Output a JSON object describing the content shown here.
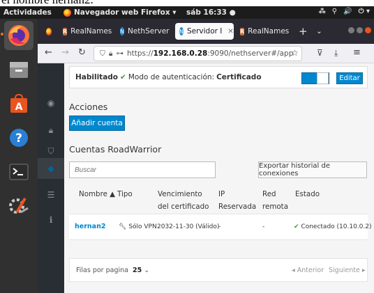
{
  "caption": "el nombre hernan2.",
  "topbar": {
    "activities": "Actividades",
    "app_menu": "Navegador web Firefox ▾",
    "clock": "sáb 16:33 ●",
    "tray": [
      "⁂",
      "⚲",
      "🔊",
      "⏻ ▾"
    ]
  },
  "browser": {
    "tabs": [
      {
        "label": "RealNames",
        "favicon": "R"
      },
      {
        "label": "NethServer",
        "favicon": "N"
      },
      {
        "label": "Servidor I",
        "favicon": "N",
        "active": true
      },
      {
        "label": "RealNames",
        "favicon": "R"
      }
    ],
    "url_prefix": "https://",
    "url_host": "192.168.0.28",
    "url_rest": ":9090/nethserver#/app"
  },
  "status": {
    "enabled_label": "Habilitado",
    "auth_label": "Modo de autenticación:",
    "auth_value": "Certificado",
    "edit_label": "Editar"
  },
  "actions": {
    "title": "Acciones",
    "add_account": "Añadir cuenta"
  },
  "accounts": {
    "title": "Cuentas RoadWarrior",
    "search_placeholder": "Buscar",
    "export_label": "Exportar historial de conexiones",
    "columns": {
      "name": "Nombre ▲",
      "type": "Tipo",
      "expiry_1": "Vencimiento",
      "expiry_2": "del certificado",
      "ip_1": "IP",
      "ip_2": "Reservada",
      "net_1": "Red",
      "net_2": "remota",
      "state": "Estado"
    },
    "rows": [
      {
        "name": "hernan2",
        "type": "Sólo VPN",
        "expiry": "2032-11-30 (Válido)",
        "ip": "-",
        "net": "-",
        "state": "Conectado (10.10.0.2)"
      }
    ]
  },
  "pagination": {
    "per_page_label": "Filas por pagina",
    "per_page_value": "25",
    "prev": "◂ Anterior",
    "next": "Siguiente ▸"
  },
  "colors": {
    "accent": "#0088ce",
    "ok": "#3f9c35",
    "ubuntu_orange": "#e95420"
  }
}
